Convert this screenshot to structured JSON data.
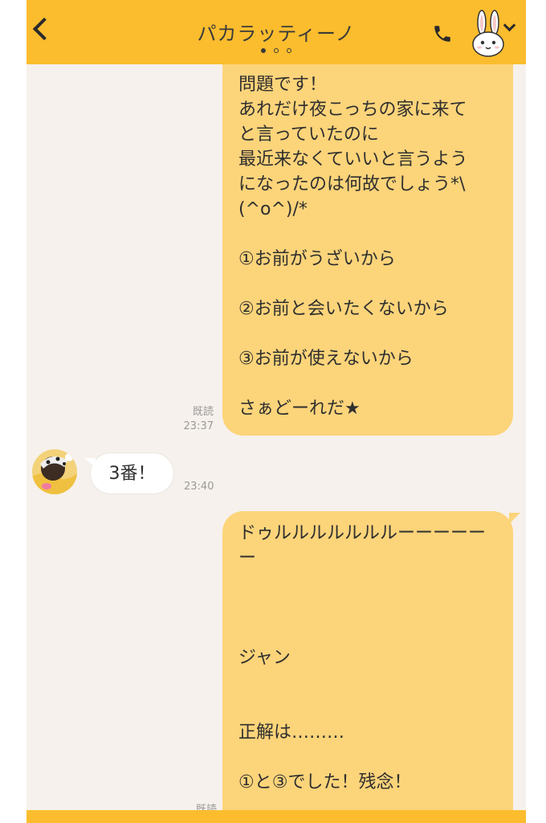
{
  "header": {
    "title": "パカラッティーノ",
    "back_icon": "chevron-left-icon",
    "call_icon": "phone-icon",
    "avatar_icon": "bunny-avatar-icon",
    "menu_icon": "chevron-down-icon",
    "page_dots": 3,
    "active_dot": 1
  },
  "messages": [
    {
      "side": "sent",
      "lines": [
        "問題です！",
        "あれだけ夜こっちの家に来て",
        "と言っていたのに",
        "最近来なくていいと言うよう",
        "になったのは何故でしょう*\\",
        "(^o^)/*",
        "",
        "①お前がうざいから",
        "",
        "②お前と会いたくないから",
        "",
        "③お前が使えないから",
        "",
        "さぁどーれだ★"
      ],
      "read": "既読",
      "time": "23:37"
    },
    {
      "side": "received",
      "text": "3番！",
      "time": "23:40"
    },
    {
      "side": "sent",
      "lines": [
        "ドゥルルルルルルルーーーーー",
        "ー",
        "",
        "",
        "",
        "ジャン",
        "",
        "",
        "正解は………",
        "",
        "①と③でした！残念！"
      ],
      "read": "既読"
    }
  ],
  "colors": {
    "header_bg": "#fbbd2e",
    "sent_bubble": "#fcd47a",
    "received_bubble": "#ffffff",
    "chat_bg": "#f6f1ec"
  }
}
